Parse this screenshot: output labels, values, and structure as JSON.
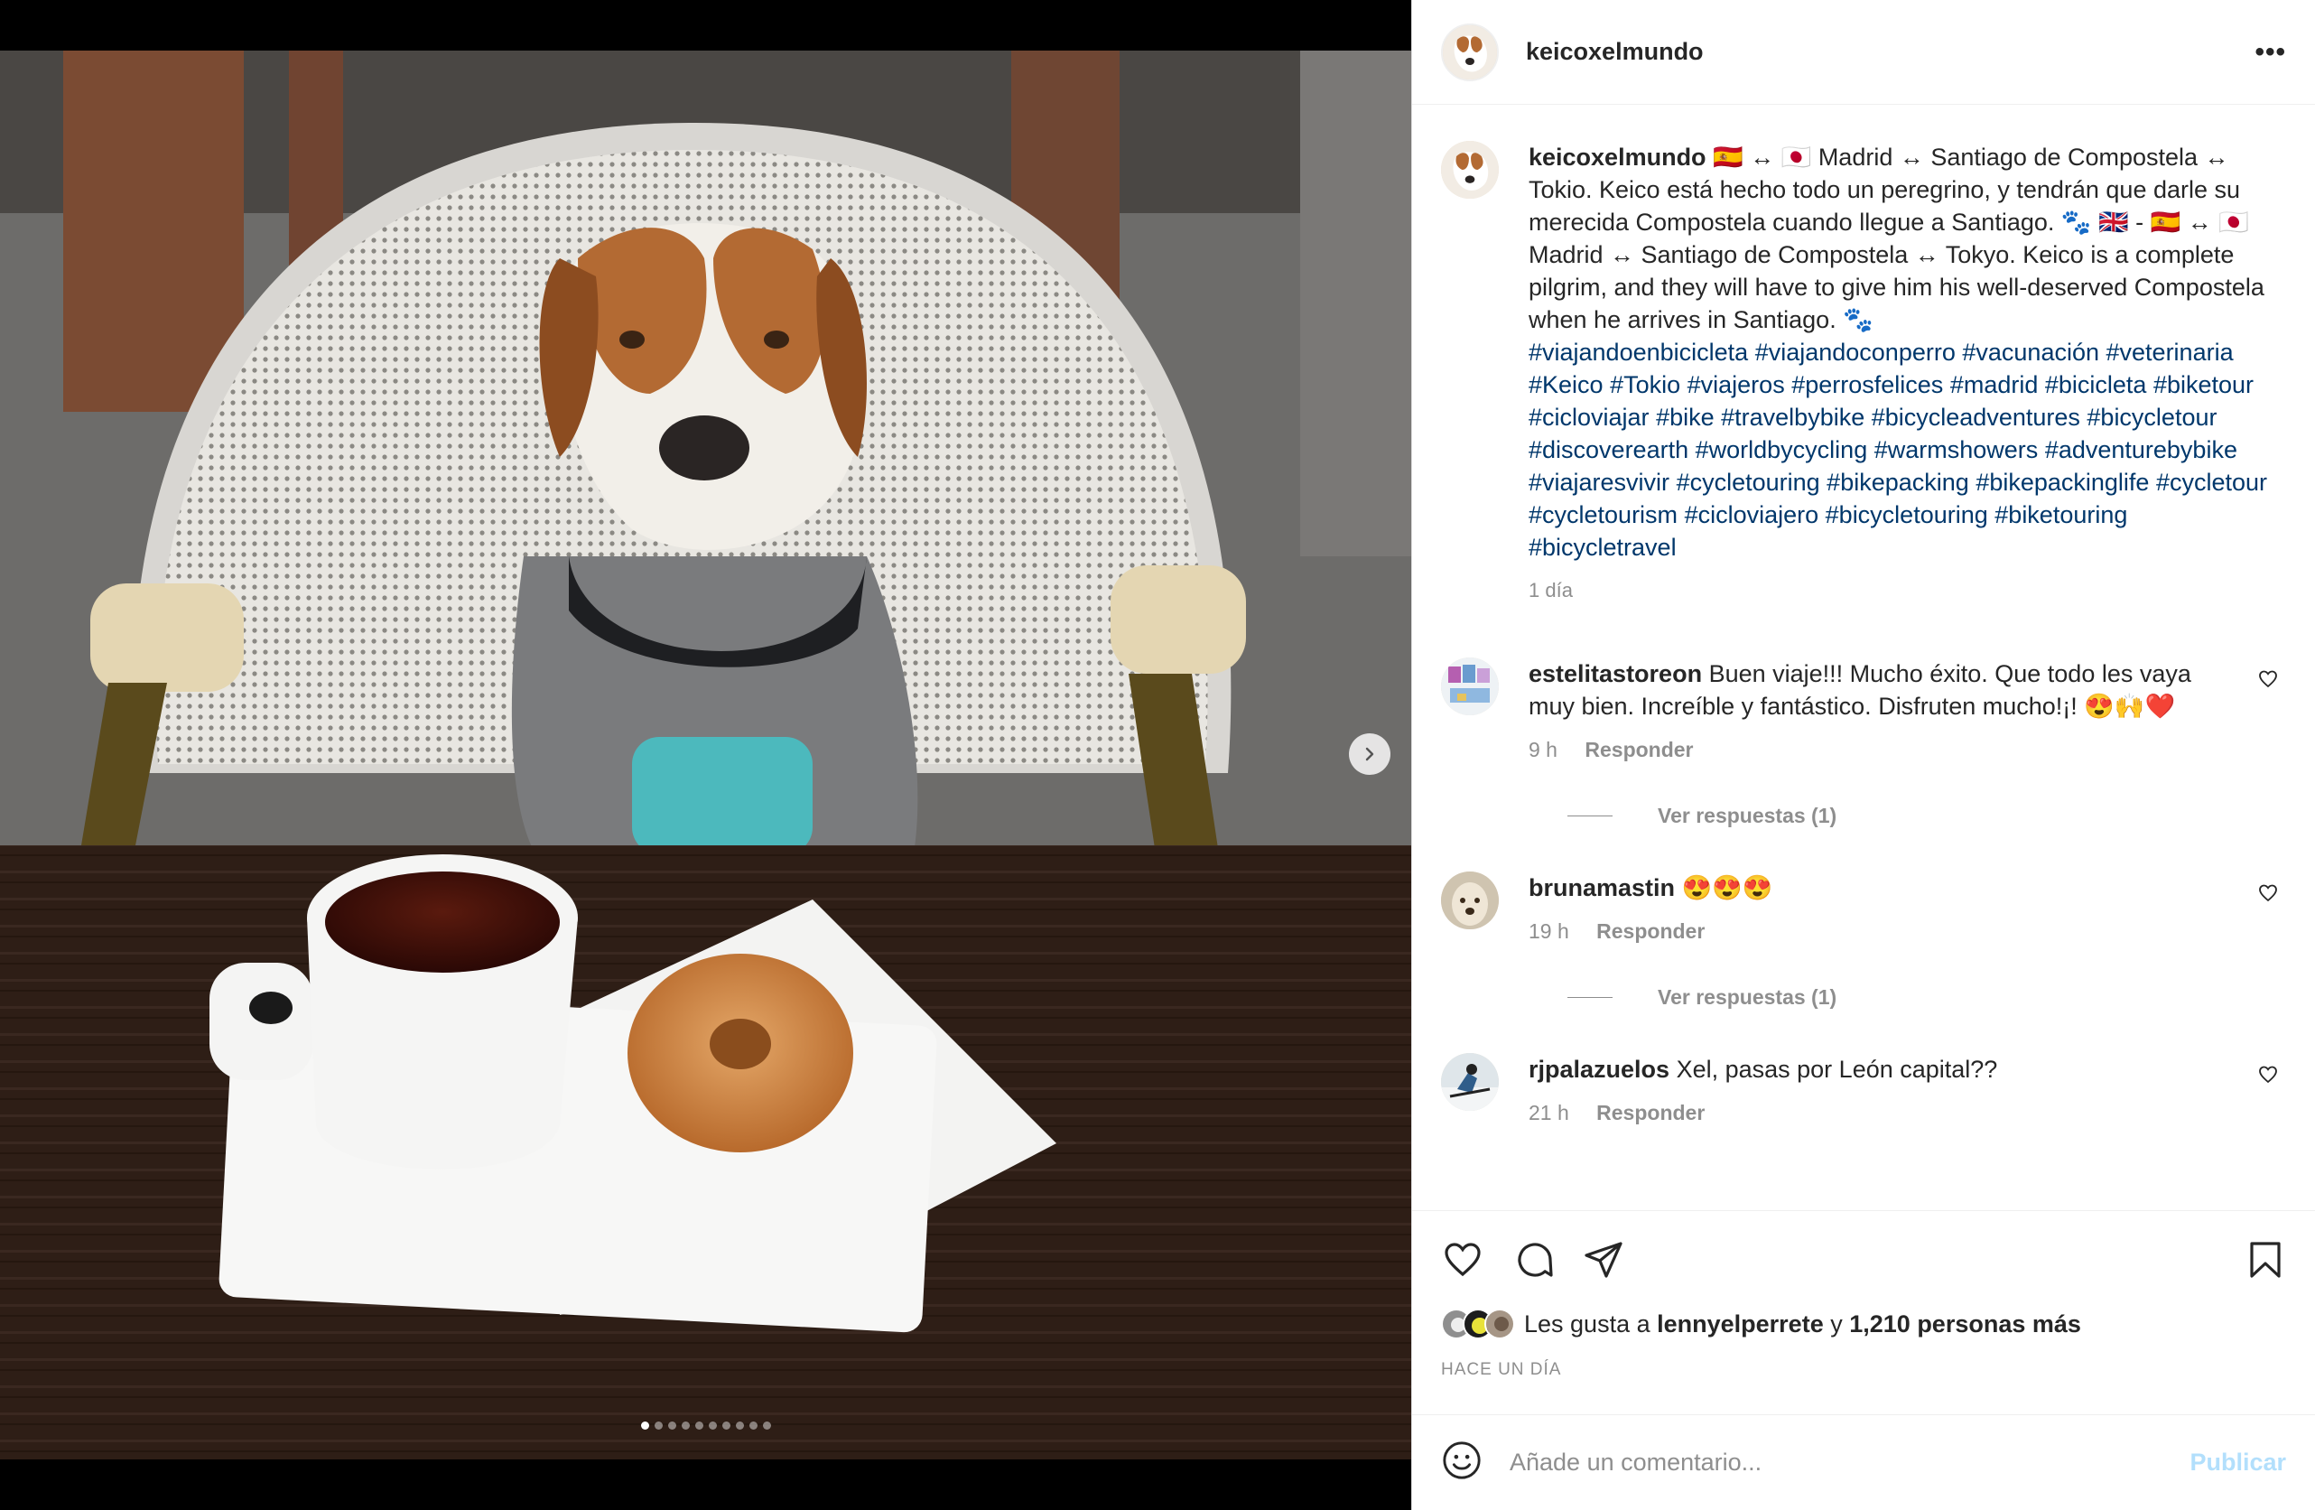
{
  "post": {
    "username": "keicoxelmundo",
    "more_label": "•••",
    "caption": {
      "username": "keicoxelmundo",
      "text_es": "🇪🇸 ↔ 🇯🇵 Madrid ↔ Santiago de Compostela ↔ Tokio. Keico está hecho todo un peregrino, y tendrán que darle su merecida Compostela cuando llegue a Santiago. 🐾 🇬🇧",
      "text_en": "- 🇪🇸 ↔ 🇯🇵 Madrid ↔ Santiago de Compostela ↔ Tokyo. Keico is a complete pilgrim, and they will have to give him his well-deserved Compostela when he arrives in Santiago. 🐾",
      "hashtags": [
        "#viajandoenbicicleta",
        "#viajandoconperro",
        "#vacunación",
        "#veterinaria",
        "#Keico",
        "#Tokio",
        "#viajeros",
        "#perrosfelices",
        "#madrid",
        "#bicicleta",
        "#biketour",
        "#cicloviajar",
        "#bike",
        "#travelbybike",
        "#bicycleadventures",
        "#bicycletour",
        "#discoverearth",
        "#worldbycycling",
        "#warmshowers",
        "#adventurebybike",
        "#viajaresvivir",
        "#cycletouring",
        "#bikepacking",
        "#bikepackinglife",
        "#cycletour",
        "#cycletourism",
        "#cicloviajero",
        "#bicycletouring",
        "#biketouring",
        "#bicycletravel"
      ],
      "time": "1 día"
    },
    "comments": [
      {
        "username": "estelitastoreon",
        "text": "Buen viaje!!! Mucho éxito. Que todo les vaya muy bien. Increíble y fantástico. Disfruten mucho!¡! 😍🙌❤️",
        "time": "9 h",
        "reply": "Responder",
        "view_replies": "Ver respuestas (1)"
      },
      {
        "username": "brunamastin",
        "text": "😍😍😍",
        "time": "19 h",
        "reply": "Responder",
        "view_replies": "Ver respuestas (1)"
      },
      {
        "username": "rjpalazuelos",
        "text": "Xel, pasas por León capital??",
        "time": "21 h",
        "reply": "Responder"
      }
    ],
    "likes": {
      "prefix": "Les gusta a",
      "user": "lennyelperrete",
      "joiner": "y",
      "others": "1,210 personas más"
    },
    "date": "HACE UN DÍA",
    "add_comment": {
      "placeholder": "Añade un comentario...",
      "publish": "Publicar"
    },
    "carousel": {
      "total": 10,
      "current": 1
    }
  },
  "icons": [
    "more-icon",
    "heart-icon",
    "comment-icon",
    "share-icon",
    "bookmark-icon",
    "emoji-icon",
    "chevron-right-icon"
  ],
  "colors": {
    "link": "#00376b",
    "muted": "#8e8e8e",
    "publish_disabled": "#b2dffc",
    "border": "#efefef"
  }
}
